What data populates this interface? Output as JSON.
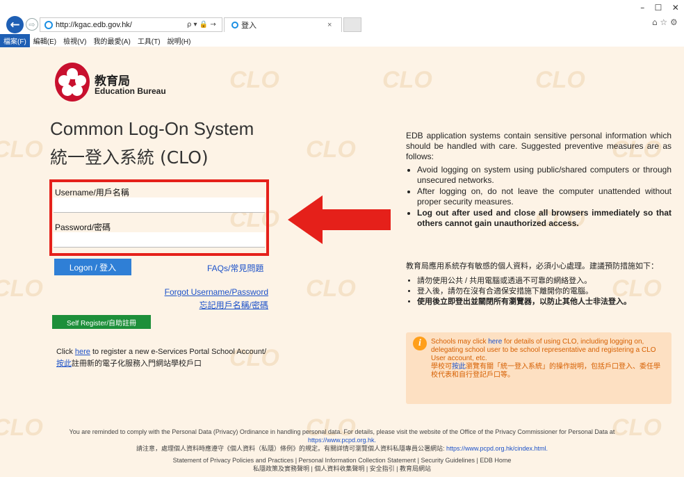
{
  "browser": {
    "url": "http://kgac.edb.gov.hk/",
    "tab_title": "登入",
    "tab_close": "×",
    "window_controls": [
      "–",
      "☐",
      "✕"
    ],
    "toolbar_icons": "⌂ ☆ ⚙",
    "addr_tools": "ρ ▾ 🔒 →",
    "menu": [
      "檔案(F)",
      "編輯(E)",
      "檢視(V)",
      "我的最愛(A)",
      "工具(T)",
      "說明(H)"
    ]
  },
  "watermark": "CLO",
  "org": {
    "name_zh": "教育局",
    "name_en": "Education Bureau"
  },
  "title": {
    "en": "Common Log-On System",
    "zh": "統一登入系統 (CLO)"
  },
  "login": {
    "username_label": "Username/用戶名稱",
    "password_label": "Password/密碼",
    "logon_button": "Logon / 登入",
    "faq_link": "FAQs/常見問題",
    "forgot_en": "Forgot Username/Password",
    "forgot_zh": "忘記用戶名稱/密碼",
    "self_register_button": "Self Register/自助註冊",
    "register_click": "Click ",
    "register_here": "here",
    "register_rest": " to register a new e-Services Portal School Account/",
    "register_zh_link": "按此",
    "register_zh_rest": "註冊新的電子化服務入門網站學校戶口"
  },
  "info": {
    "en_intro": "EDB application systems contain sensitive personal information which should be handled with care. Suggested preventive measures are as follows:",
    "en_items": [
      "Avoid logging on system using public/shared computers or through unsecured networks.",
      "After logging on, do not leave the computer unattended without proper security measures."
    ],
    "en_bold_item": "Log out after used and close all browsers immediately so that others cannot gain unauthorized access.",
    "zh_intro": "教育局應用系統存有敏感的個人資料，必須小心處理。建議預防措施如下：",
    "zh_items": [
      "請勿使用公共 / 共用電腦或透過不可靠的網絡登入。",
      "登入後，請勿在沒有合適保安措施下離開你的電腦。"
    ],
    "zh_bold_item": "使用後立即登出並關閉所有瀏覽器，以防止其他人士非法登入。"
  },
  "notice": {
    "en_a": "Schools may click ",
    "en_here": "here",
    "en_b": " for details of using CLO, including logging on, delegating school user to be school representative and registering a CLO User account, etc.",
    "zh_a": "學校可",
    "zh_link": "按此",
    "zh_b": "瀏覽有關「統一登入系統」的操作說明，包括戶口登入、委任學校代表和自行登記戶口等。"
  },
  "footer": {
    "line1": "You are reminded to comply with the Personal Data (Privacy) Ordinance in handling personal data. For details, please visit the website of the Office of the Privacy Commissioner for Personal Data at",
    "line1_link": "https://www.pcpd.org.hk.",
    "line2": "請注意，處理個人資料時應遵守《個人資料（私隱）條例》的規定。有關詳情可瀏覽個人資料私隱專員公署網站:",
    "line2_link": "https://www.pcpd.org.hk/cindex.html.",
    "line3": "Statement of Privacy Policies and Practices  |  Personal Information Collection Statement | Security Guidelines | EDB Home",
    "line4": "私隱政策及實務聲明  |  個人資料收集聲明  |  安全指引  |  教育局網站"
  },
  "colors": {
    "accent": "#1e5fb4",
    "alert": "#e5201a",
    "background": "#fdf3e6"
  }
}
